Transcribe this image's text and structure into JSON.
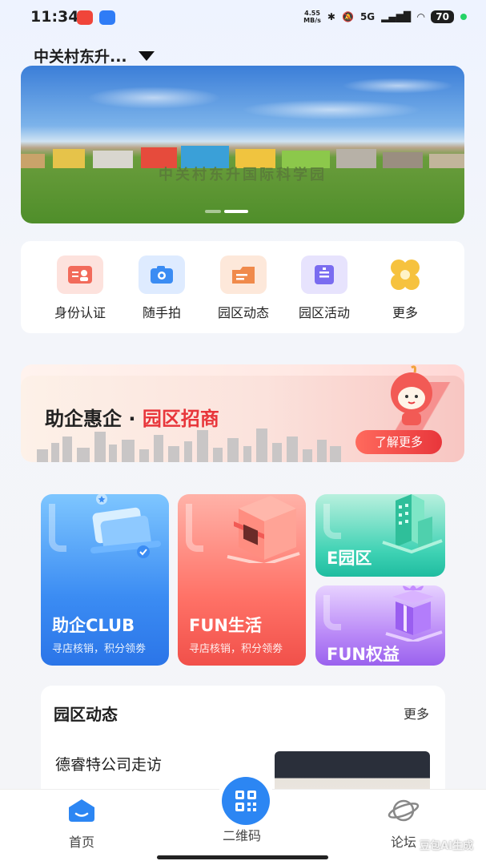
{
  "status_bar": {
    "time": "11:34",
    "net_speed_value": "4.55",
    "net_speed_unit": "MB/s",
    "signal_label": "5G",
    "battery": "70",
    "accent_dot_color": "#25d366"
  },
  "header": {
    "location": "中关村东升..."
  },
  "banner": {
    "image_text": "中关村东升国际科学园",
    "carousel_total": 2,
    "carousel_active": 2
  },
  "quick_menu": [
    {
      "label": "身份认证",
      "icon": "id-card-icon",
      "color": "#f26b5b"
    },
    {
      "label": "随手拍",
      "icon": "camera-icon",
      "color": "#3b8cf3"
    },
    {
      "label": "园区动态",
      "icon": "news-folder-icon",
      "color": "#f08a4b"
    },
    {
      "label": "园区活动",
      "icon": "activity-board-icon",
      "color": "#7a6cf0"
    },
    {
      "label": "更多",
      "icon": "more-clover-icon",
      "color": "#f6c23e"
    }
  ],
  "promo": {
    "title_main": "助企惠企 · ",
    "title_accent": "园区招商",
    "button": "了解更多"
  },
  "features": {
    "club": {
      "title": "助企CLUB",
      "subtitle": "寻店核销，积分领劵"
    },
    "fun": {
      "title": "FUN生活",
      "subtitle": "寻店核销，积分领劵"
    },
    "epark": {
      "title": "E园区"
    },
    "rights": {
      "title": "FUN权益"
    }
  },
  "news": {
    "heading": "园区动态",
    "more": "更多",
    "items": [
      {
        "title": "德睿特公司走访"
      }
    ]
  },
  "tabbar": {
    "home": "首页",
    "qr": "二维码",
    "forum": "论坛"
  },
  "watermark": "豆包AI生成",
  "colors": {
    "primary": "#2c86f3",
    "promo_accent": "#e8363b"
  }
}
